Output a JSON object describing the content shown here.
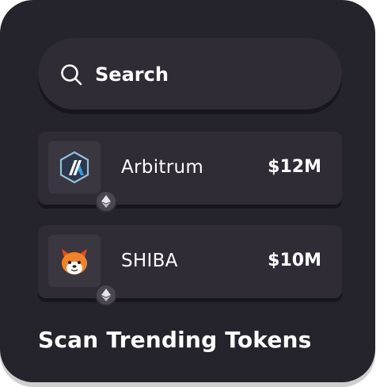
{
  "search": {
    "label": "Search",
    "icon": "search-icon"
  },
  "tokens": [
    {
      "name": "Arbitrum",
      "value": "$12M",
      "logo": "arbitrum-logo-icon",
      "chain": "ethereum-icon"
    },
    {
      "name": "SHIBA",
      "value": "$10M",
      "logo": "shiba-logo-icon",
      "chain": "ethereum-icon"
    }
  ],
  "footer": {
    "title": "Scan Trending Tokens"
  },
  "colors": {
    "card": "#25232c",
    "surface": "#2f2c36",
    "tile": "#3a3741",
    "text": "#ffffff"
  }
}
